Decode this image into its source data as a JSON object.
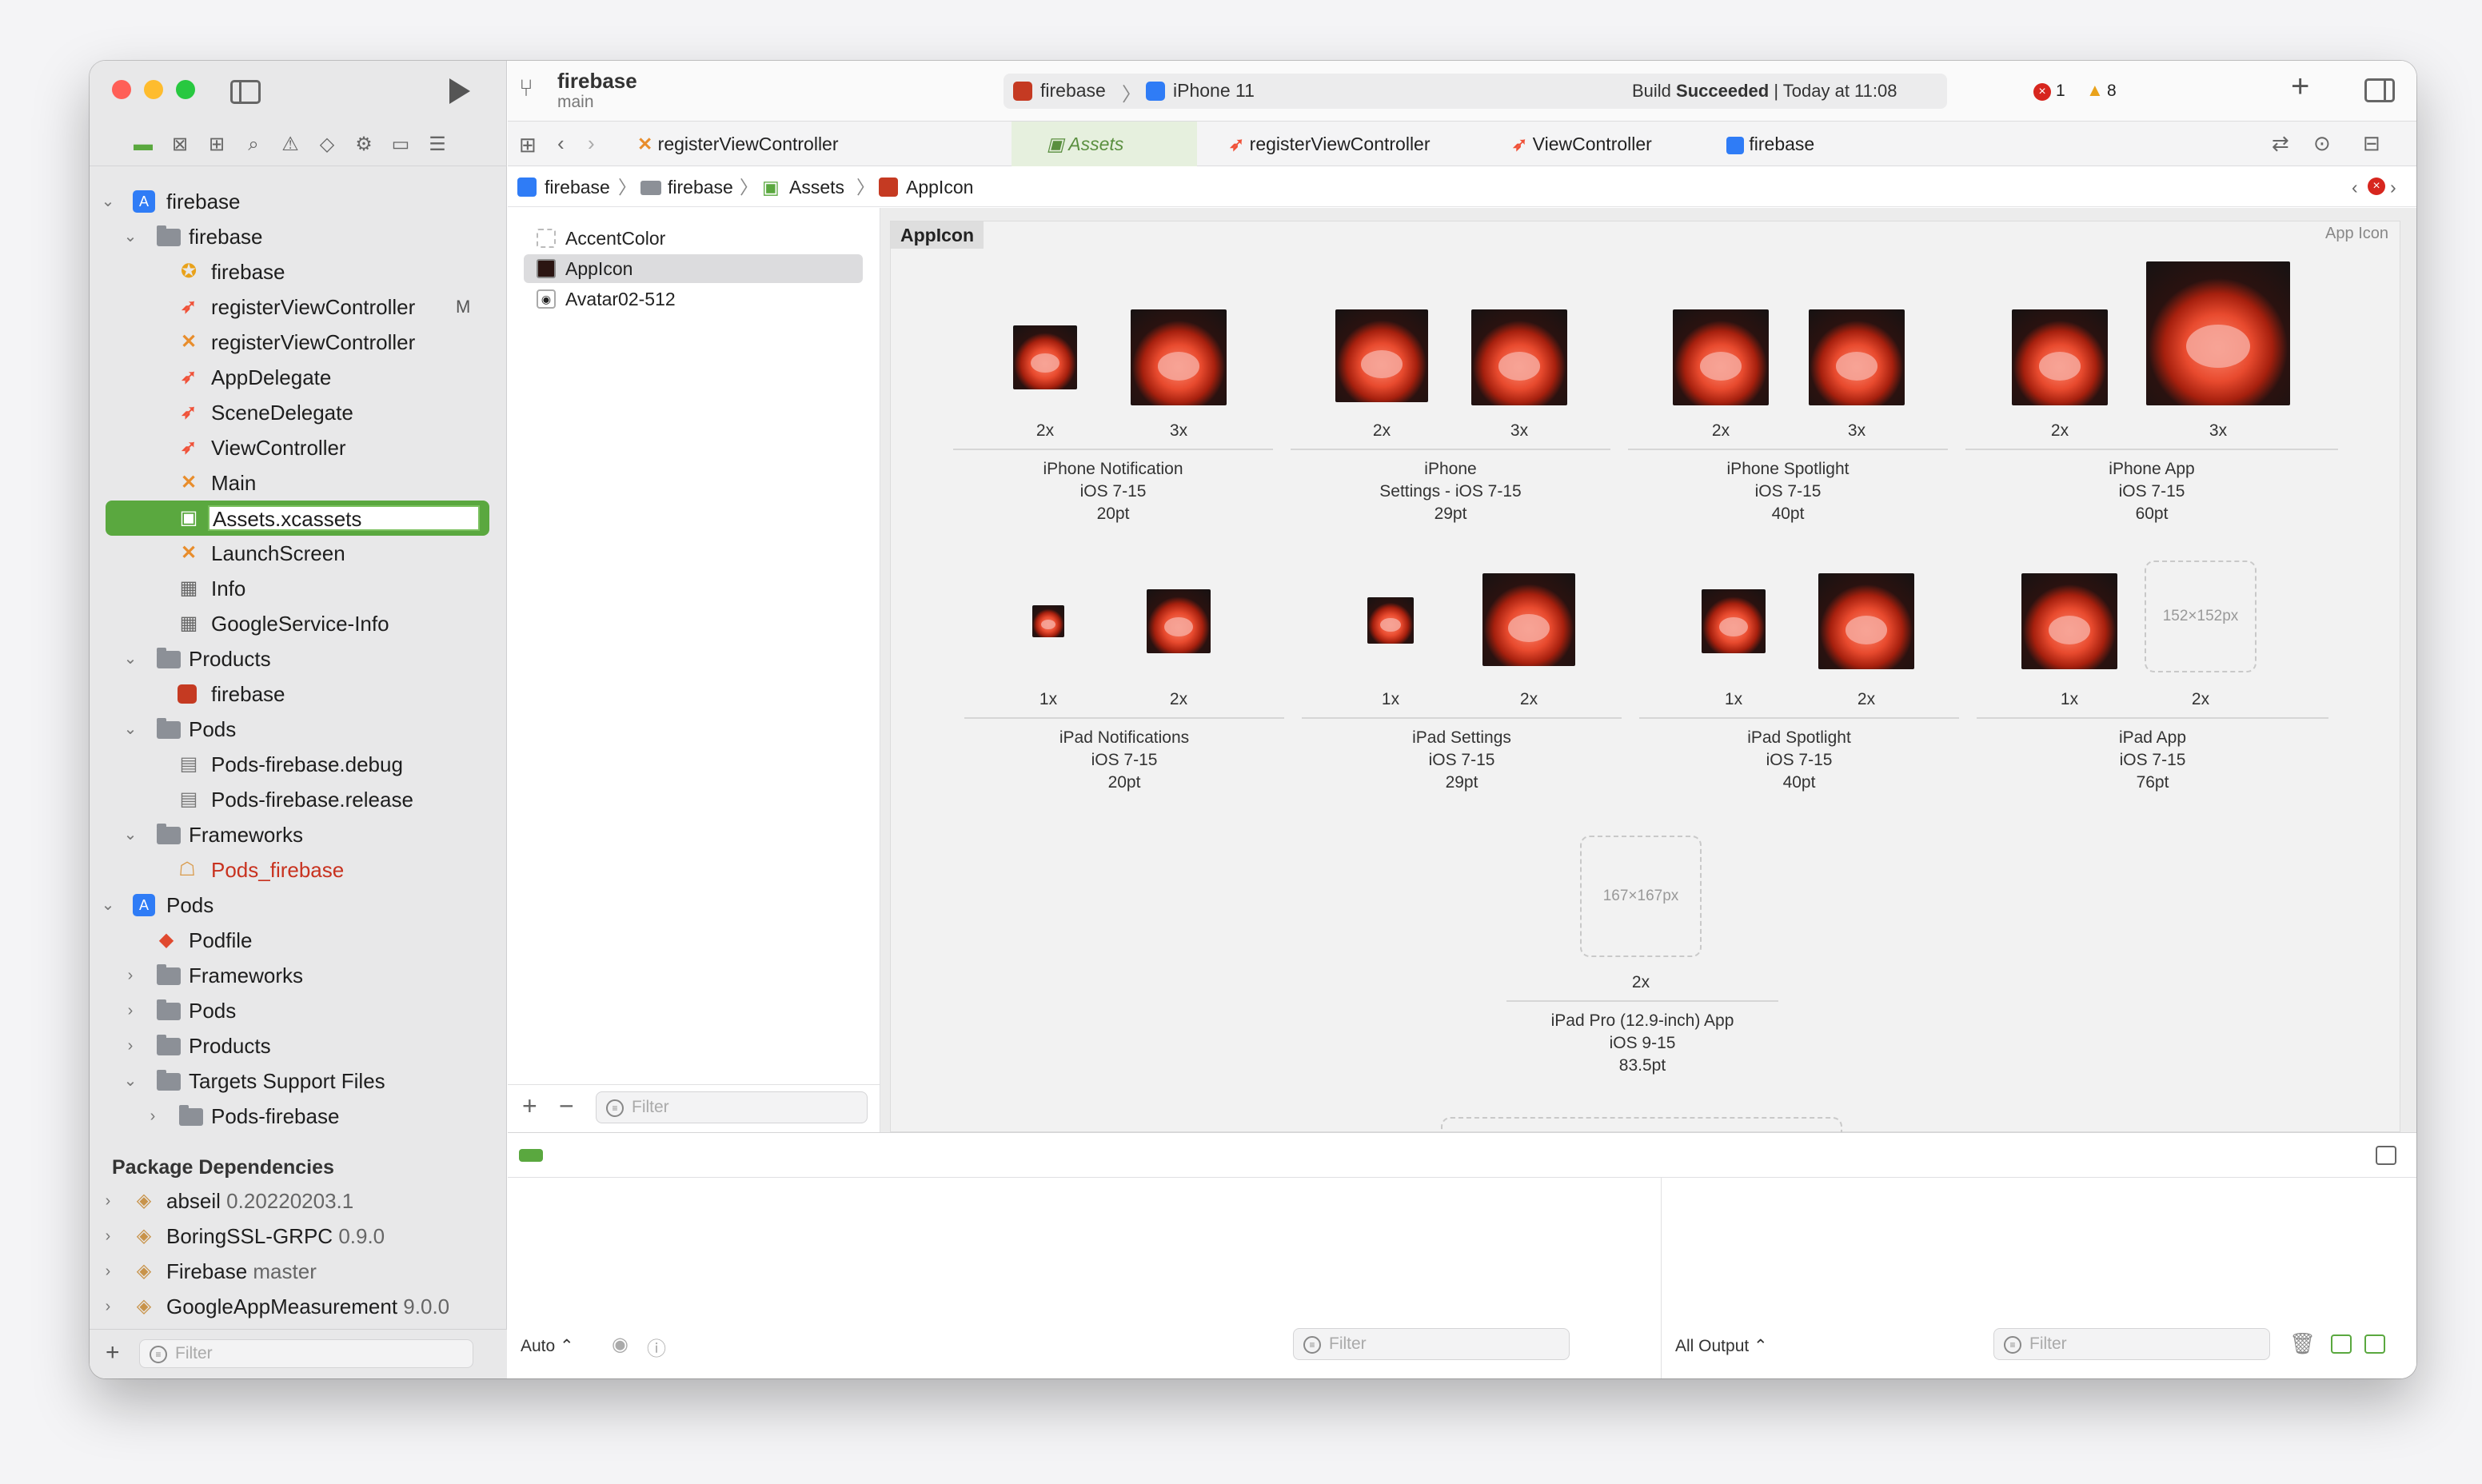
{
  "window": {
    "project": "firebase",
    "branch": "main",
    "scheme": "firebase",
    "device": "iPhone 11",
    "status_prefix": "Build",
    "status_bold": "Succeeded",
    "status_time": "| Today at 11:08",
    "errors": "1",
    "warnings": "8"
  },
  "sidebar": {
    "tree": [
      {
        "label": "firebase",
        "kind": "project"
      },
      {
        "label": "firebase",
        "kind": "folder"
      },
      {
        "label": "firebase",
        "kind": "entitlement"
      },
      {
        "label": "registerViewController",
        "kind": "swift",
        "badge": "M"
      },
      {
        "label": "registerViewController",
        "kind": "xib"
      },
      {
        "label": "AppDelegate",
        "kind": "swift"
      },
      {
        "label": "SceneDelegate",
        "kind": "swift"
      },
      {
        "label": "ViewController",
        "kind": "swift"
      },
      {
        "label": "Main",
        "kind": "xib"
      },
      {
        "label": "Assets.xcassets",
        "kind": "assets"
      },
      {
        "label": "LaunchScreen",
        "kind": "xib"
      },
      {
        "label": "Info",
        "kind": "plist"
      },
      {
        "label": "GoogleService-Info",
        "kind": "plist"
      },
      {
        "label": "Products",
        "kind": "folder"
      },
      {
        "label": "firebase",
        "kind": "app"
      },
      {
        "label": "Pods",
        "kind": "folder"
      },
      {
        "label": "Pods-firebase.debug",
        "kind": "file"
      },
      {
        "label": "Pods-firebase.release",
        "kind": "file"
      },
      {
        "label": "Frameworks",
        "kind": "folder"
      },
      {
        "label": "Pods_firebase",
        "kind": "framework"
      },
      {
        "label": "Pods",
        "kind": "project"
      },
      {
        "label": "Podfile",
        "kind": "ruby"
      },
      {
        "label": "Frameworks",
        "kind": "folder"
      },
      {
        "label": "Pods",
        "kind": "folder"
      },
      {
        "label": "Products",
        "kind": "folder"
      },
      {
        "label": "Targets Support Files",
        "kind": "folder"
      },
      {
        "label": "Pods-firebase",
        "kind": "folder"
      }
    ],
    "package_header": "Package Dependencies",
    "packages": [
      {
        "name": "abseil",
        "version": "0.20220203.1"
      },
      {
        "name": "BoringSSL-GRPC",
        "version": "0.9.0"
      },
      {
        "name": "Firebase",
        "version": "master"
      },
      {
        "name": "GoogleAppMeasurement",
        "version": "9.0.0"
      }
    ],
    "filter_placeholder": "Filter"
  },
  "tabs": [
    {
      "label": "registerViewController",
      "kind": "xib"
    },
    {
      "label": "Assets",
      "kind": "assets",
      "active": true
    },
    {
      "label": "registerViewController",
      "kind": "swift"
    },
    {
      "label": "ViewController",
      "kind": "swift"
    },
    {
      "label": "firebase",
      "kind": "project"
    }
  ],
  "jumpbar": [
    "firebase",
    "firebase",
    "Assets",
    "AppIcon"
  ],
  "assets": {
    "items": [
      "AccentColor",
      "AppIcon",
      "Avatar02-512"
    ],
    "filter_placeholder": "Filter"
  },
  "iconset": {
    "name": "AppIcon",
    "type_label": "App Icon",
    "groups": [
      {
        "line1": "iPhone Notification",
        "line2": "iOS 7-15",
        "line3": "20pt",
        "s1": "2x",
        "s2": "3x"
      },
      {
        "line1": "iPhone",
        "line2": "Settings - iOS 7-15",
        "line3": "29pt",
        "s1": "2x",
        "s2": "3x"
      },
      {
        "line1": "iPhone Spotlight",
        "line2": "iOS 7-15",
        "line3": "40pt",
        "s1": "2x",
        "s2": "3x"
      },
      {
        "line1": "iPhone App",
        "line2": "iOS 7-15",
        "line3": "60pt",
        "s1": "2x",
        "s2": "3x"
      },
      {
        "line1": "iPad Notifications",
        "line2": "iOS 7-15",
        "line3": "20pt",
        "s1": "1x",
        "s2": "2x"
      },
      {
        "line1": "iPad Settings",
        "line2": "iOS 7-15",
        "line3": "29pt",
        "s1": "1x",
        "s2": "2x"
      },
      {
        "line1": "iPad Spotlight",
        "line2": "iOS 7-15",
        "line3": "40pt",
        "s1": "1x",
        "s2": "2x"
      },
      {
        "line1": "iPad App",
        "line2": "iOS 7-15",
        "line3": "76pt",
        "s1": "1x",
        "s2": "2x"
      },
      {
        "line1": "iPad Pro (12.9-inch) App",
        "line2": "iOS 9-15",
        "line3": "83.5pt",
        "s1": "2x"
      }
    ],
    "placeholder_ipad_app": "152×152px",
    "placeholder_ipad_pro": "167×167px"
  },
  "debug": {
    "auto_label": "Auto ⌃",
    "output_label": "All Output ⌃",
    "filter_placeholder": "Filter"
  },
  "colors": {
    "accent": "#5aa83f",
    "swift": "#f05138",
    "error": "#d7261e",
    "warning": "#e9a21b"
  }
}
